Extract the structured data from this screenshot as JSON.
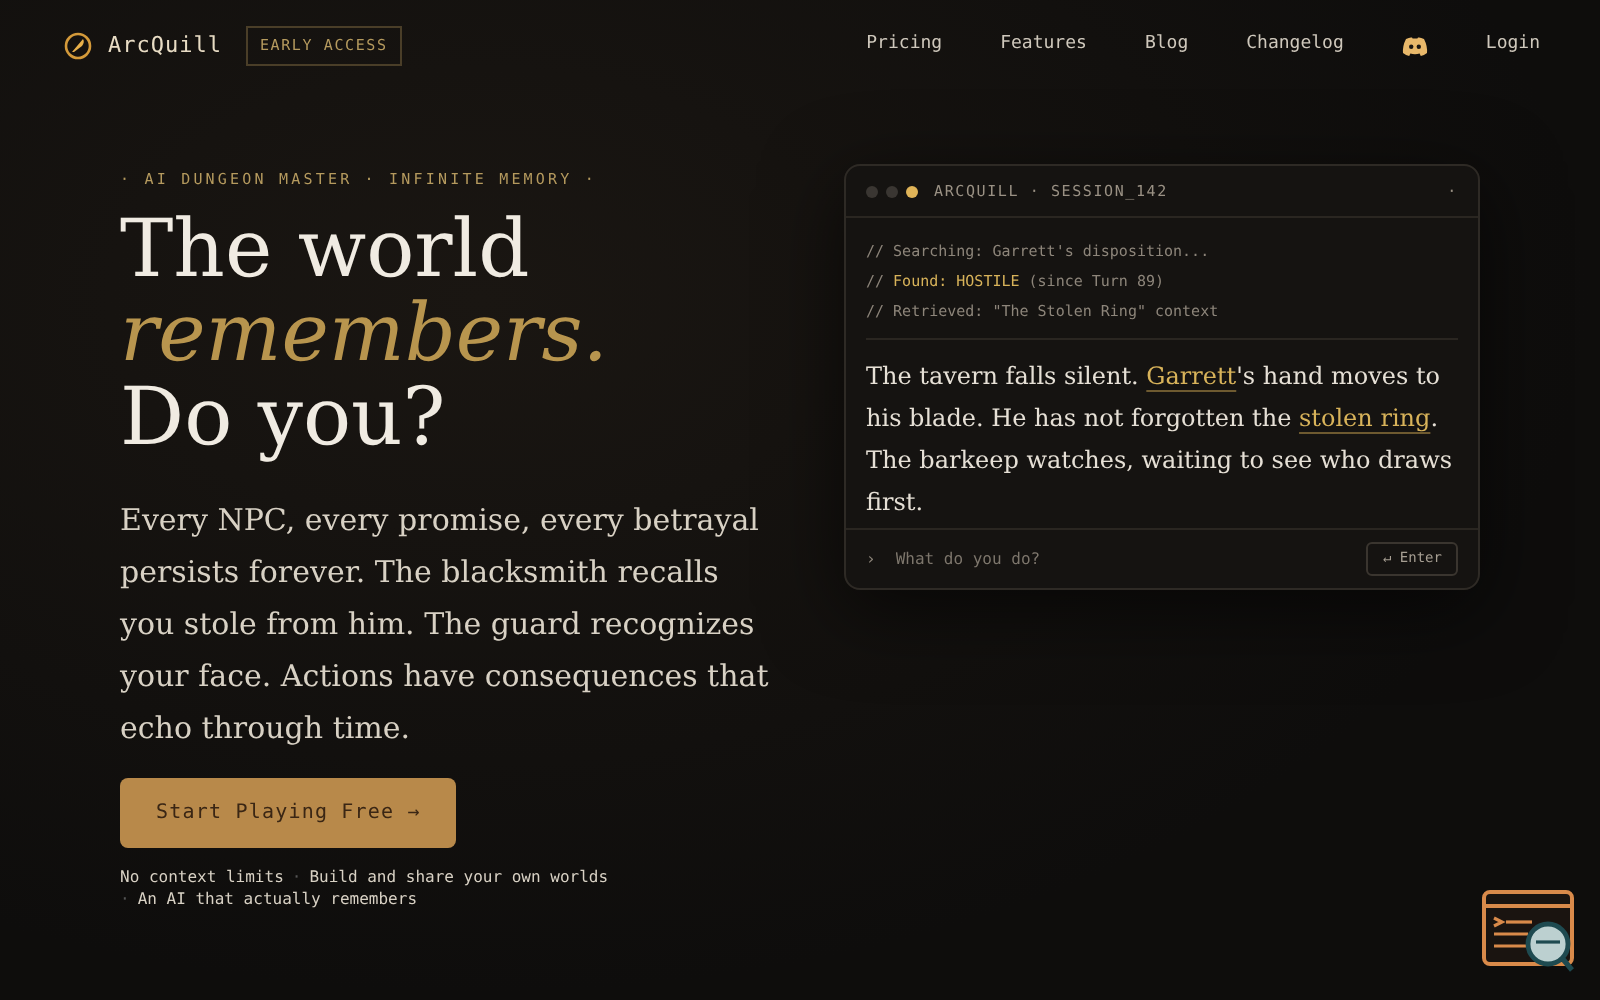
{
  "brand": {
    "name": "ArcQuill",
    "badge": "EARLY ACCESS"
  },
  "nav": {
    "links": [
      "Pricing",
      "Features",
      "Blog",
      "Changelog"
    ],
    "login": "Login"
  },
  "hero": {
    "eyebrow": "· AI DUNGEON MASTER · INFINITE MEMORY ·",
    "title_lines": [
      {
        "text": "The world",
        "accent": false
      },
      {
        "text": "remembers.",
        "accent": true
      },
      {
        "text": "Do you?",
        "accent": false
      }
    ],
    "lead": "Every NPC, every promise, every betrayal persists forever. The blacksmith recalls you stole from him. The guard recognizes your face. Actions have consequences that echo through time.",
    "cta": "Start Playing Free →",
    "separator": "·",
    "features": [
      "No context limits",
      "Build and share your own worlds",
      "An AI that actually remembers"
    ]
  },
  "terminal": {
    "title": "ARCQUILL · SESSION_142",
    "menu": "·",
    "log": [
      [
        {
          "text": "// Searching: Garrett's disposition...",
          "highlight": false
        }
      ],
      [
        {
          "text": "// ",
          "highlight": false
        },
        {
          "text": "Found: HOSTILE",
          "highlight": true
        },
        {
          "text": " (since Turn 89)",
          "highlight": false
        }
      ],
      [
        {
          "text": "// Retrieved: \"The Stolen Ring\" context",
          "highlight": false
        }
      ]
    ],
    "story": [
      {
        "text": "The tavern falls silent. ",
        "link": false
      },
      {
        "text": "Garrett",
        "link": true
      },
      {
        "text": "'s hand moves to his blade. He has not forgotten the ",
        "link": false
      },
      {
        "text": "stolen ring",
        "link": true
      },
      {
        "text": ". The barkeep watches, waiting to see who draws first.",
        "link": false
      }
    ],
    "prompt": "›",
    "placeholder": "What do you do?",
    "enter": "↵ Enter"
  }
}
